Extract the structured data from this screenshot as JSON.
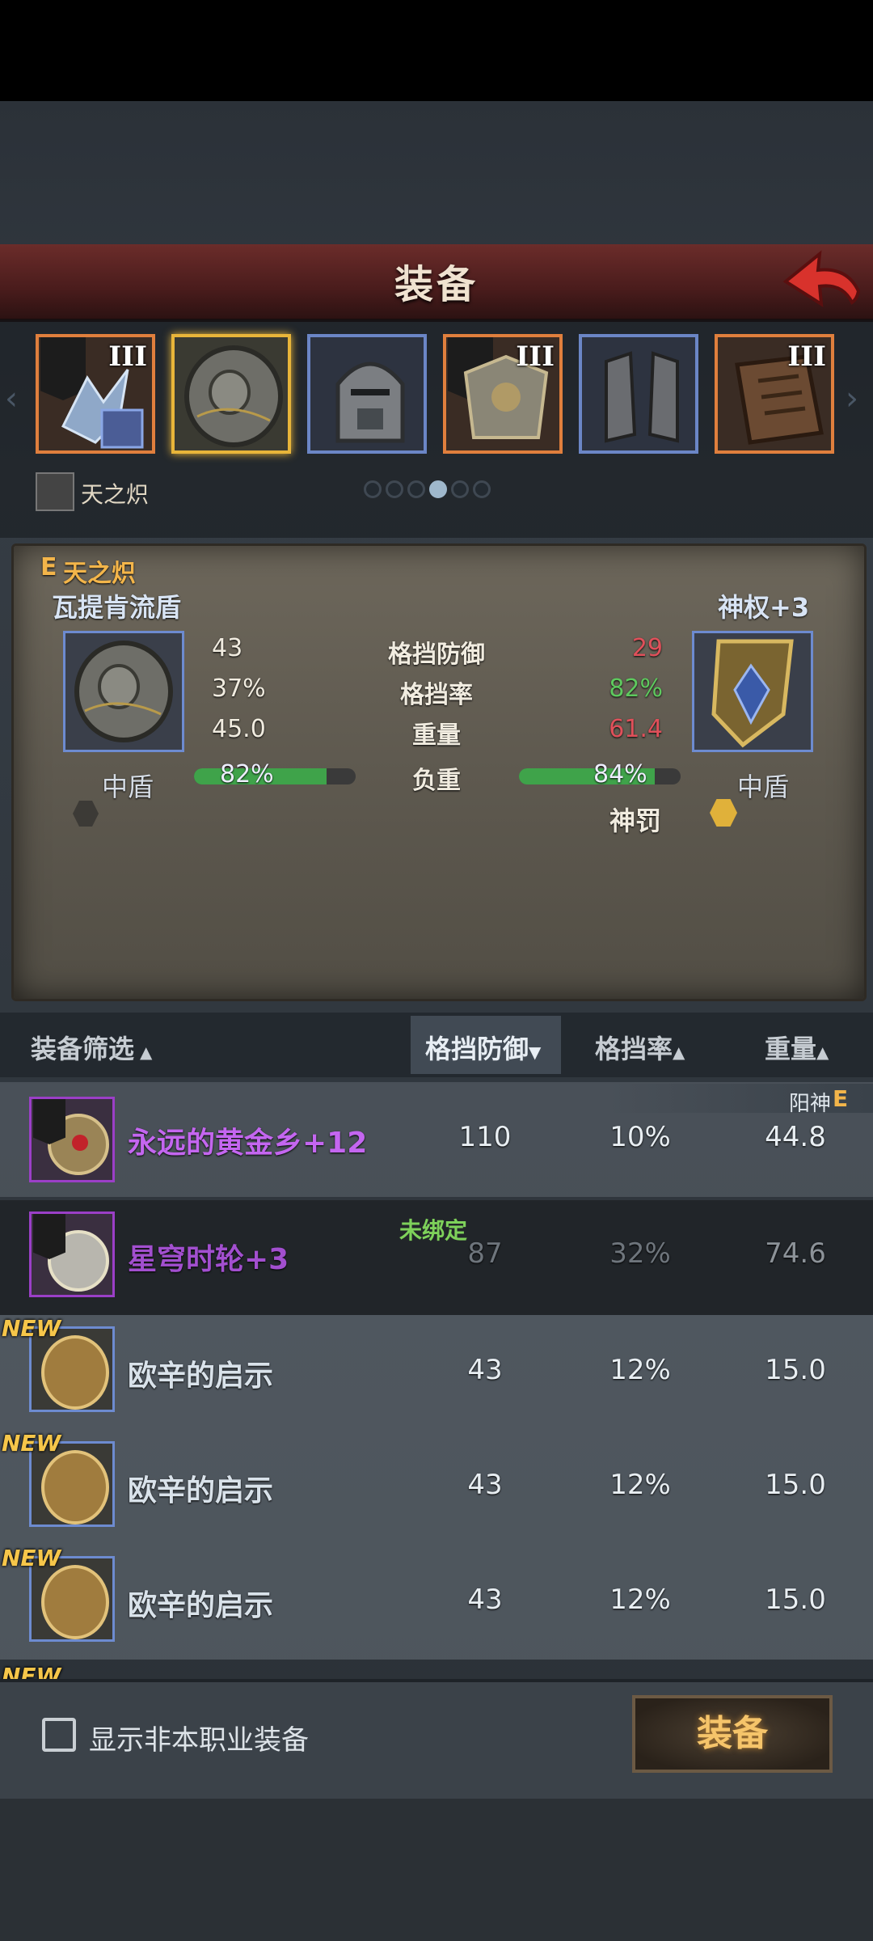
{
  "header": {
    "title": "装备"
  },
  "slots": [
    {
      "tier": "III",
      "rarity": "orange",
      "icon": "ice-wing-armor-icon"
    },
    {
      "tier": "",
      "rarity": "selected",
      "icon": "round-shield-icon"
    },
    {
      "tier": "",
      "rarity": "blue",
      "icon": "knight-helmet-icon"
    },
    {
      "tier": "III",
      "rarity": "orange",
      "icon": "gilded-armor-icon"
    },
    {
      "tier": "",
      "rarity": "blue",
      "icon": "greaves-icon"
    },
    {
      "tier": "III",
      "rarity": "orange",
      "icon": "book-icon"
    }
  ],
  "character": {
    "name": "天之炽"
  },
  "page_dots": {
    "count": 6,
    "active_index": 3
  },
  "compare": {
    "badge": "E",
    "owner": "天之炽",
    "left_name": "瓦提肯流盾",
    "right_name": "神权+3",
    "left_type": "中盾",
    "right_type": "中盾",
    "stats": [
      {
        "label": "格挡防御",
        "left": "43",
        "right": "29",
        "right_color": "#e0505a"
      },
      {
        "label": "格挡率",
        "left": "37%",
        "right": "82%",
        "right_color": "#5ec95e"
      },
      {
        "label": "重量",
        "left": "45.0",
        "right": "61.4",
        "right_color": "#e0505a"
      }
    ],
    "load": {
      "label": "负重",
      "left": "82%",
      "right": "84%",
      "left_fraction": 0.82,
      "right_fraction": 0.84
    },
    "extra_label": "神罚"
  },
  "list_header": {
    "filter": "装备筛选",
    "col1": "格挡防御",
    "col2": "格挡率",
    "col3": "重量"
  },
  "rows": [
    {
      "name": "永远的黄金乡+12",
      "block": "110",
      "rate": "10%",
      "weight": "44.8",
      "tag": "阳神",
      "tag_badge": "E",
      "rarity": "purple",
      "new": ""
    },
    {
      "name": "星穹时轮+3",
      "block": "87",
      "rate": "32%",
      "weight": "74.6",
      "tag": "未绑定",
      "rarity": "purple",
      "new": ""
    },
    {
      "name": "欧辛的启示",
      "block": "43",
      "rate": "12%",
      "weight": "15.0",
      "rarity": "blue",
      "new": "NEW"
    },
    {
      "name": "欧辛的启示",
      "block": "43",
      "rate": "12%",
      "weight": "15.0",
      "rarity": "blue",
      "new": "NEW"
    },
    {
      "name": "欧辛的启示",
      "block": "43",
      "rate": "12%",
      "weight": "15.0",
      "rarity": "blue",
      "new": "NEW"
    }
  ],
  "partial_new": "NEW",
  "footer": {
    "checkbox_label": "显示非本职业装备",
    "equip_button": "装备"
  }
}
